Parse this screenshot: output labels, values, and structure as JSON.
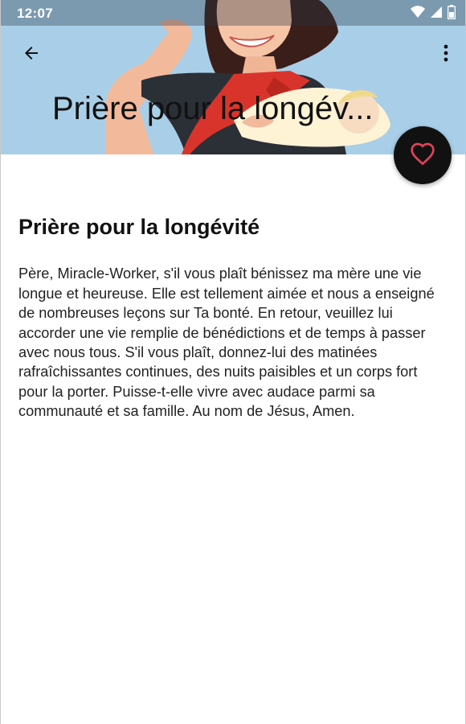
{
  "status_bar": {
    "time": "12:07",
    "icons": [
      "wifi-icon",
      "signal-icon",
      "battery-icon"
    ]
  },
  "toolbar": {
    "back_icon": "arrow-left-icon",
    "menu_icon": "more-vertical-icon",
    "title": "Prière pour la longév..."
  },
  "header": {
    "image": "illustration-mother-holding-baby",
    "background_color": "#a9cfe8"
  },
  "fab": {
    "icon": "heart-outline-icon",
    "background_color": "#111111",
    "icon_color": "#e0435a"
  },
  "article": {
    "title": "Prière pour la longévité",
    "body": "Père, Miracle-Worker, s'il vous plaît bénissez ma mère une vie longue et heureuse. Elle est tellement aimée et nous a enseigné de nombreuses leçons sur Ta bonté. En retour, veuillez lui accorder une vie remplie de bénédictions et de temps à passer avec nous tous. S'il vous plaît, donnez-lui des matinées rafraîchissantes continues, des nuits paisibles et un corps fort pour la porter. Puisse-t-elle vivre avec audace parmi sa communauté et sa famille. Au nom de Jésus, Amen."
  }
}
